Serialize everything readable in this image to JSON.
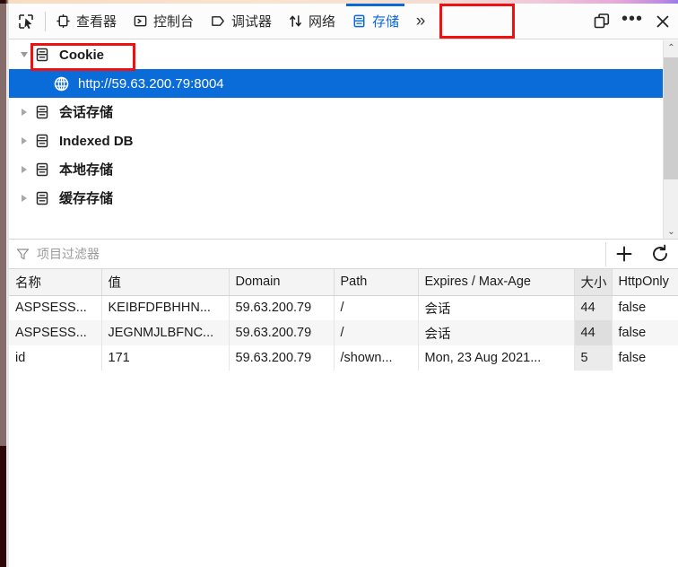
{
  "toolbar": {
    "picker_icon": "element-picker-icon",
    "tabs": [
      {
        "id": "inspector",
        "label": "查看器",
        "icon": "inspector-icon",
        "active": false
      },
      {
        "id": "console",
        "label": "控制台",
        "icon": "console-icon",
        "active": false
      },
      {
        "id": "debugger",
        "label": "调试器",
        "icon": "debugger-icon",
        "active": false
      },
      {
        "id": "network",
        "label": "网络",
        "icon": "network-icon",
        "active": false
      },
      {
        "id": "storage",
        "label": "存储",
        "icon": "storage-icon",
        "active": true
      }
    ],
    "overflow_label": "»",
    "dock_icon": "dock-split-icon",
    "meatball_label": "•••",
    "close_label": "✕",
    "active_color": "#0a68d8",
    "annotation_color": "#ee1111"
  },
  "tree": {
    "items": [
      {
        "id": "cookie",
        "label": "Cookie",
        "icon": "storage-type-icon",
        "expanded": true,
        "level": 0,
        "selected": false,
        "annotated": true
      },
      {
        "id": "cookie-origin",
        "label": "http://59.63.200.79:8004",
        "icon": "globe-icon",
        "expanded": null,
        "level": 1,
        "selected": true,
        "annotated": false
      },
      {
        "id": "session",
        "label": "会话存储",
        "icon": "storage-type-icon",
        "expanded": false,
        "level": 0,
        "selected": false,
        "annotated": false
      },
      {
        "id": "indexeddb",
        "label": "Indexed DB",
        "icon": "storage-type-icon",
        "expanded": false,
        "level": 0,
        "selected": false,
        "annotated": false
      },
      {
        "id": "localstorage",
        "label": "本地存储",
        "icon": "storage-type-icon",
        "expanded": false,
        "level": 0,
        "selected": false,
        "annotated": false
      },
      {
        "id": "cachestorage",
        "label": "缓存存储",
        "icon": "storage-type-icon",
        "expanded": false,
        "level": 0,
        "selected": false,
        "annotated": false
      }
    ],
    "selection_color": "#0a6cd8",
    "scrollbar": {
      "up_arrow": "⌃",
      "down_arrow": "⌄"
    }
  },
  "filter": {
    "icon": "filter-funnel-icon",
    "placeholder": "项目过滤器",
    "value": "",
    "add_label": "+",
    "add_icon": "plus-icon",
    "refresh_icon": "refresh-icon",
    "refresh_label": "↻"
  },
  "table": {
    "columns": [
      {
        "key": "name",
        "label": "名称",
        "sorted": false
      },
      {
        "key": "value",
        "label": "值",
        "sorted": false
      },
      {
        "key": "domain",
        "label": "Domain",
        "sorted": false
      },
      {
        "key": "path",
        "label": "Path",
        "sorted": false
      },
      {
        "key": "expires",
        "label": "Expires / Max-Age",
        "sorted": false
      },
      {
        "key": "size",
        "label": "大小",
        "sorted": true
      },
      {
        "key": "httponly",
        "label": "HttpOnly",
        "sorted": false
      }
    ],
    "rows": [
      {
        "name": "ASPSESS...",
        "value": "KEIBFDFBHHN...",
        "domain": "59.63.200.79",
        "path": "/",
        "expires": "会话",
        "size": "44",
        "httponly": "false"
      },
      {
        "name": "ASPSESS...",
        "value": "JEGNMJLBFNC...",
        "domain": "59.63.200.79",
        "path": "/",
        "expires": "会话",
        "size": "44",
        "httponly": "false"
      },
      {
        "name": "id",
        "value": "171",
        "domain": "59.63.200.79",
        "path": "/shown...",
        "expires": "Mon, 23 Aug 2021...",
        "size": "5",
        "httponly": "false"
      }
    ]
  }
}
